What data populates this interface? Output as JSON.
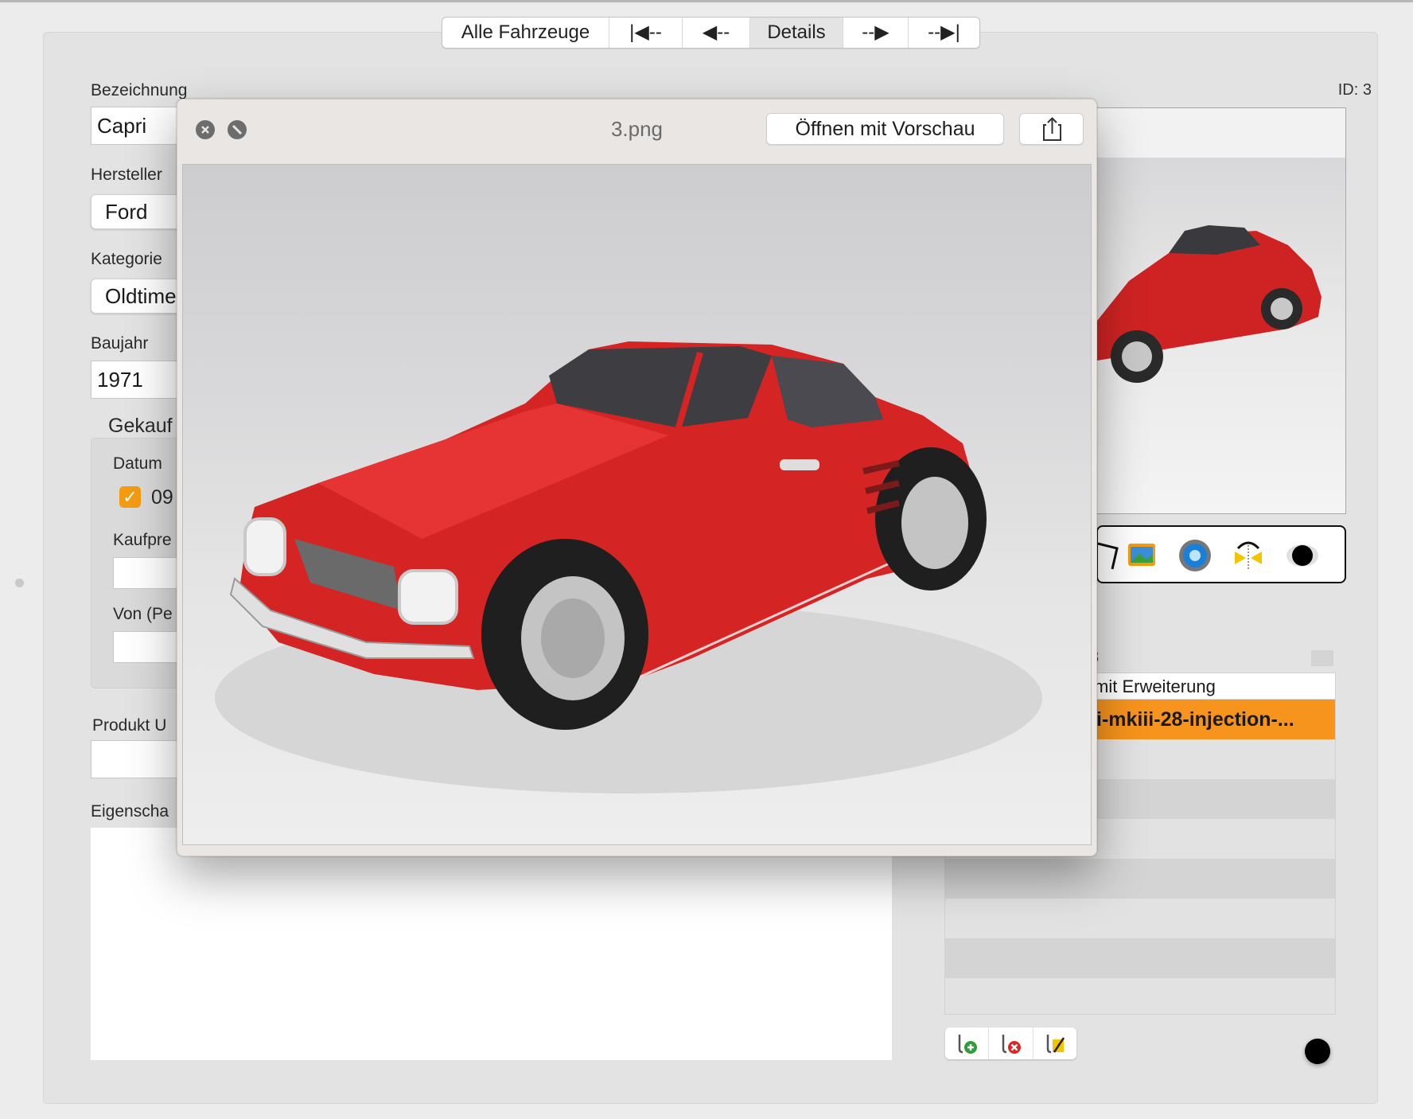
{
  "nav": {
    "segments": [
      "Alle Fahrzeuge",
      "|◀--",
      "◀--",
      "Details",
      "--▶",
      "--▶|"
    ],
    "active_index": 3
  },
  "form": {
    "bezeichnung_label": "Bezeichnung",
    "bezeichnung_value": "Capri",
    "hersteller_label": "Hersteller",
    "hersteller_value": "Ford",
    "kategorie_label": "Kategorie",
    "kategorie_value": "Oldtime",
    "baujahr_label": "Baujahr",
    "baujahr_value": "1971",
    "gekauft_label": "Gekauf",
    "datum_label": "Datum",
    "datum_checked": true,
    "datum_value": "09",
    "kaufpreis_label": "Kaufpre",
    "von_label": "Von  (Pe",
    "produkt_label": "Produkt U",
    "eigenschaften_label": "Eigenscha"
  },
  "record": {
    "id_label": "ID: 3"
  },
  "toolbox": {
    "icons": [
      "frame-icon",
      "photos-icon",
      "camera-aperture-icon",
      "flip-icon",
      "eye-icon"
    ]
  },
  "attachments": {
    "header_fragment": "3",
    "column_header": "mit Erweiterung",
    "selected_row": "i-mkiii-28-injection-...",
    "toolbar_icons": [
      "add-attachment-icon",
      "remove-attachment-icon",
      "edit-attachment-icon"
    ]
  },
  "quicklook": {
    "filename": "3.png",
    "open_button": "Öffnen mit Vorschau",
    "share_icon": "share-icon"
  },
  "colors": {
    "accent_orange": "#f7941d",
    "checkbox_orange": "#f39c12",
    "car_red": "#d42424"
  }
}
